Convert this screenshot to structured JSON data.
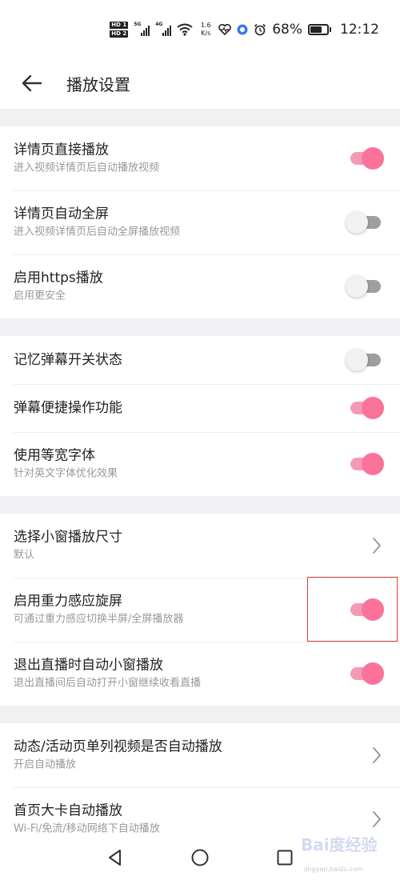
{
  "status_bar": {
    "hd1": "HD 1",
    "hd2": "HD 2",
    "net1": "5G",
    "net2": "4G",
    "speed_value": "1.6",
    "speed_unit": "K/s",
    "battery_text": "68%",
    "battery_level": 0.68,
    "time": "12:12"
  },
  "header": {
    "back_icon": "arrow-left-icon",
    "title": "播放设置"
  },
  "groups": [
    {
      "items": [
        {
          "label": "详情页直接播放",
          "sub": "进入视频详情页后自动播放视频",
          "control": "toggle",
          "on": true
        },
        {
          "label": "详情页自动全屏",
          "sub": "进入视频详情页后自动全屏播放视频",
          "control": "toggle",
          "on": false
        },
        {
          "label": "启用https播放",
          "sub": "启用更安全",
          "control": "toggle",
          "on": false
        }
      ]
    },
    {
      "items": [
        {
          "label": "记忆弹幕开关状态",
          "sub": "",
          "control": "toggle",
          "on": false
        },
        {
          "label": "弹幕便捷操作功能",
          "sub": "",
          "control": "toggle",
          "on": true
        },
        {
          "label": "使用等宽字体",
          "sub": "针对英文字体优化效果",
          "control": "toggle",
          "on": true
        }
      ]
    },
    {
      "items": [
        {
          "label": "选择小窗播放尺寸",
          "sub": "默认",
          "control": "chevron"
        },
        {
          "label": "启用重力感应旋屏",
          "sub": "可通过重力感应切换半屏/全屏播放器",
          "control": "toggle",
          "on": true
        },
        {
          "label": "退出直播时自动小窗播放",
          "sub": "退出直播间后自动打开小窗继续收看直播",
          "control": "toggle",
          "on": true
        }
      ]
    },
    {
      "items": [
        {
          "label": "动态/活动页单列视频是否自动播放",
          "sub": "开启自动播放",
          "control": "chevron"
        },
        {
          "label": "首页大卡自动播放",
          "sub": "Wi-Fi/免流/移动网络下自动播放",
          "control": "chevron"
        }
      ]
    }
  ],
  "nav_bar": {
    "back_icon": "triangle-back-icon",
    "home_icon": "circle-home-icon",
    "recent_icon": "square-recent-icon"
  },
  "watermark": {
    "text": "Bai度经验",
    "url": "jingyan.baidu.com"
  },
  "colors": {
    "accent": "#fb7299",
    "accent_track": "#f39ab6",
    "off_track": "#9e9e9e",
    "off_knob": "#f1f1f1",
    "divider_band": "#f1f1f3",
    "highlight": "#e53935"
  }
}
